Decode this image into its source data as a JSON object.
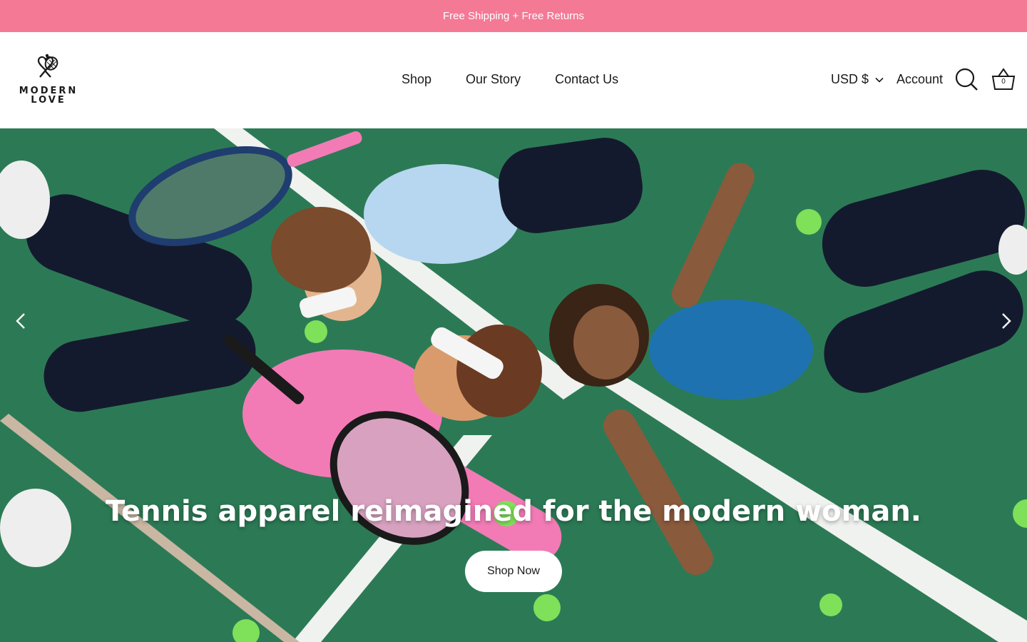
{
  "announcement": {
    "text": "Free Shipping + Free Returns"
  },
  "brand": {
    "line1": "MODERN",
    "line2": "LOVE",
    "logo_icon": "heart-tennis-racket-icon"
  },
  "nav": {
    "items": [
      {
        "label": "Shop"
      },
      {
        "label": "Our Story"
      },
      {
        "label": "Contact Us"
      }
    ]
  },
  "header_actions": {
    "currency": "USD $",
    "account": "Account",
    "search_icon": "search-icon",
    "cart_icon": "basket-icon",
    "cart_count": "0"
  },
  "hero": {
    "headline": "Tennis apparel reimagined for the modern woman.",
    "cta_label": "Shop Now",
    "prev_icon": "chevron-left-icon",
    "next_icon": "chevron-right-icon",
    "image_description_icon": "hero-photo"
  },
  "colors": {
    "announcement_bg": "#f47995",
    "court_green": "#2c7a55",
    "text": "#1a1a1a"
  }
}
